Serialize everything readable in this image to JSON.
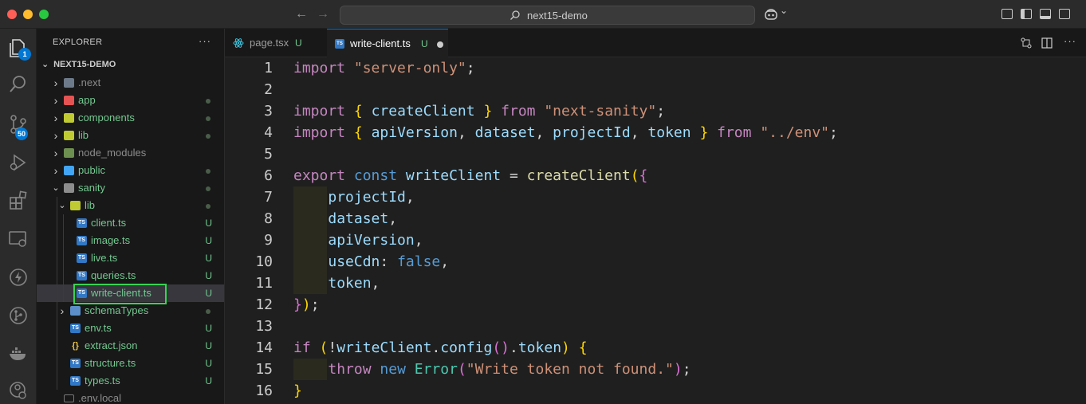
{
  "window": {
    "search_text": "next15-demo",
    "back_arrow": "←",
    "forward_arrow": "→",
    "copilot_chevron": "⌄"
  },
  "activity": {
    "explorer_badge": "1",
    "scm_badge": "50"
  },
  "sidebar": {
    "header": "EXPLORER",
    "more": "···",
    "project": "NEXT15-DEMO",
    "items": [
      {
        "name": "next",
        "label": ".next",
        "depth": 0,
        "kind": "folder",
        "open": false,
        "status": "",
        "icon": "folder-gear"
      },
      {
        "name": "app",
        "label": "app",
        "depth": 0,
        "kind": "folder",
        "open": false,
        "status": "dot",
        "icon": "folder-app"
      },
      {
        "name": "components",
        "label": "components",
        "depth": 0,
        "kind": "folder",
        "open": false,
        "status": "dot",
        "icon": "folder-components"
      },
      {
        "name": "lib",
        "label": "lib",
        "depth": 0,
        "kind": "folder",
        "open": false,
        "status": "dot",
        "icon": "folder-lib"
      },
      {
        "name": "node-modules",
        "label": "node_modules",
        "depth": 0,
        "kind": "folder",
        "open": false,
        "status": "",
        "icon": "folder-node"
      },
      {
        "name": "public",
        "label": "public",
        "depth": 0,
        "kind": "folder",
        "open": false,
        "status": "dot",
        "icon": "folder-public"
      },
      {
        "name": "sanity",
        "label": "sanity",
        "depth": 0,
        "kind": "folder",
        "open": true,
        "status": "dot",
        "icon": "folder-sanity"
      },
      {
        "name": "sanity-lib",
        "label": "lib",
        "depth": 1,
        "kind": "folder",
        "open": true,
        "status": "dot",
        "icon": "folder-lib-open"
      },
      {
        "name": "client-ts",
        "label": "client.ts",
        "depth": 2,
        "kind": "file",
        "status": "U",
        "icon": "ts-file"
      },
      {
        "name": "image-ts",
        "label": "image.ts",
        "depth": 2,
        "kind": "file",
        "status": "U",
        "icon": "ts-file"
      },
      {
        "name": "live-ts",
        "label": "live.ts",
        "depth": 2,
        "kind": "file",
        "status": "U",
        "icon": "ts-file"
      },
      {
        "name": "queries-ts",
        "label": "queries.ts",
        "depth": 2,
        "kind": "file",
        "status": "U",
        "icon": "ts-file"
      },
      {
        "name": "write-client-ts",
        "label": "write-client.ts",
        "depth": 2,
        "kind": "file",
        "status": "U",
        "icon": "ts-file",
        "selected": true
      },
      {
        "name": "schematypes",
        "label": "schemaTypes",
        "depth": 1,
        "kind": "folder",
        "open": false,
        "status": "dot",
        "icon": "folder-types"
      },
      {
        "name": "env-ts",
        "label": "env.ts",
        "depth": 1,
        "kind": "file",
        "status": "U",
        "icon": "ts-file"
      },
      {
        "name": "extract-json",
        "label": "extract.json",
        "depth": 1,
        "kind": "file",
        "status": "U",
        "icon": "json-file"
      },
      {
        "name": "structure-ts",
        "label": "structure.ts",
        "depth": 1,
        "kind": "file",
        "status": "U",
        "icon": "ts-file"
      },
      {
        "name": "types-ts",
        "label": "types.ts",
        "depth": 1,
        "kind": "file",
        "status": "U",
        "icon": "ts-file"
      },
      {
        "name": "env-local",
        "label": ".env.local",
        "depth": 0,
        "kind": "file",
        "status": "",
        "icon": "env-file"
      }
    ]
  },
  "tabs": [
    {
      "label": "page.tsx",
      "status": "U",
      "active": false,
      "icon": "react-icon"
    },
    {
      "label": "write-client.ts",
      "status": "U",
      "active": true,
      "dirty": true,
      "icon": "ts-file"
    }
  ],
  "editor": {
    "line_numbers": [
      "1",
      "2",
      "3",
      "4",
      "5",
      "6",
      "7",
      "8",
      "9",
      "10",
      "11",
      "12",
      "13",
      "14",
      "15",
      "16"
    ],
    "lines": [
      [
        [
          "kw",
          "import"
        ],
        [
          "punc",
          " "
        ],
        [
          "str",
          "\"server-only\""
        ],
        [
          "punc",
          ";"
        ]
      ],
      [],
      [
        [
          "kw",
          "import"
        ],
        [
          "punc",
          " "
        ],
        [
          "br1",
          "{"
        ],
        [
          "punc",
          " "
        ],
        [
          "var",
          "createClient"
        ],
        [
          "punc",
          " "
        ],
        [
          "br1",
          "}"
        ],
        [
          "punc",
          " "
        ],
        [
          "kw",
          "from"
        ],
        [
          "punc",
          " "
        ],
        [
          "str",
          "\"next-sanity\""
        ],
        [
          "punc",
          ";"
        ]
      ],
      [
        [
          "kw",
          "import"
        ],
        [
          "punc",
          " "
        ],
        [
          "br1",
          "{"
        ],
        [
          "punc",
          " "
        ],
        [
          "var",
          "apiVersion"
        ],
        [
          "punc",
          ", "
        ],
        [
          "var",
          "dataset"
        ],
        [
          "punc",
          ", "
        ],
        [
          "var",
          "projectId"
        ],
        [
          "punc",
          ", "
        ],
        [
          "var",
          "token"
        ],
        [
          "punc",
          " "
        ],
        [
          "br1",
          "}"
        ],
        [
          "punc",
          " "
        ],
        [
          "kw",
          "from"
        ],
        [
          "punc",
          " "
        ],
        [
          "str",
          "\"../env\""
        ],
        [
          "punc",
          ";"
        ]
      ],
      [],
      [
        [
          "kw",
          "export"
        ],
        [
          "punc",
          " "
        ],
        [
          "kw2",
          "const"
        ],
        [
          "punc",
          " "
        ],
        [
          "var",
          "writeClient"
        ],
        [
          "punc",
          " = "
        ],
        [
          "fn",
          "createClient"
        ],
        [
          "br1",
          "("
        ],
        [
          "br2",
          "{"
        ]
      ],
      [
        [
          "punc",
          "    "
        ],
        [
          "var",
          "projectId"
        ],
        [
          "punc",
          ","
        ]
      ],
      [
        [
          "punc",
          "    "
        ],
        [
          "var",
          "dataset"
        ],
        [
          "punc",
          ","
        ]
      ],
      [
        [
          "punc",
          "    "
        ],
        [
          "var",
          "apiVersion"
        ],
        [
          "punc",
          ","
        ]
      ],
      [
        [
          "punc",
          "    "
        ],
        [
          "var",
          "useCdn"
        ],
        [
          "punc",
          ": "
        ],
        [
          "kw2",
          "false"
        ],
        [
          "punc",
          ","
        ]
      ],
      [
        [
          "punc",
          "    "
        ],
        [
          "var",
          "token"
        ],
        [
          "punc",
          ","
        ]
      ],
      [
        [
          "br2",
          "}"
        ],
        [
          "br1",
          ")"
        ],
        [
          "punc",
          ";"
        ]
      ],
      [],
      [
        [
          "kw",
          "if"
        ],
        [
          "punc",
          " "
        ],
        [
          "br1",
          "("
        ],
        [
          "punc",
          "!"
        ],
        [
          "var",
          "writeClient"
        ],
        [
          "punc",
          "."
        ],
        [
          "var",
          "config"
        ],
        [
          "br2",
          "()"
        ],
        [
          "punc",
          "."
        ],
        [
          "var",
          "token"
        ],
        [
          "br1",
          ")"
        ],
        [
          "punc",
          " "
        ],
        [
          "br1",
          "{"
        ]
      ],
      [
        [
          "punc",
          "    "
        ],
        [
          "kw",
          "throw"
        ],
        [
          "punc",
          " "
        ],
        [
          "kw2",
          "new"
        ],
        [
          "punc",
          " "
        ],
        [
          "cls",
          "Error"
        ],
        [
          "br2",
          "("
        ],
        [
          "str",
          "\"Write token not found.\""
        ],
        [
          "br2",
          ")"
        ],
        [
          "punc",
          ";"
        ]
      ],
      [
        [
          "br1",
          "}"
        ]
      ]
    ]
  },
  "colors": {
    "accent": "#0078d4",
    "untracked": "#73c991",
    "highlight_box": "#39d353"
  }
}
